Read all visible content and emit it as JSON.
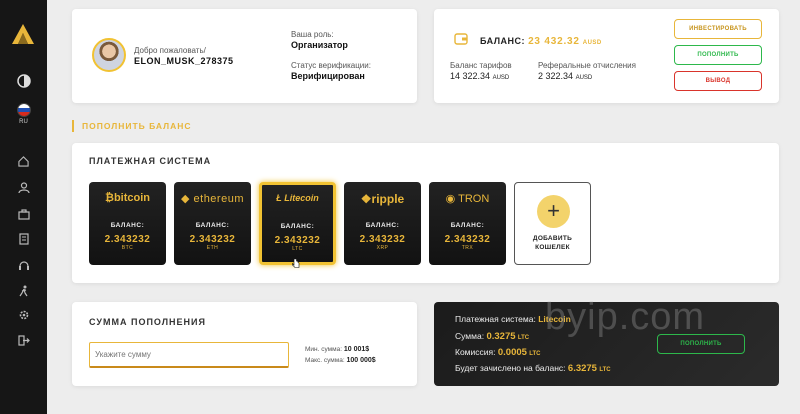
{
  "sidebar": {
    "language": "RU"
  },
  "header": {
    "welcome_label": "Добро пожаловать/",
    "username": "ELON_MUSK_278375",
    "role_label": "Ваша роль:",
    "role_value": "Организатор",
    "verification_label": "Статус верификации:",
    "verification_value": "Верифицирован"
  },
  "balance": {
    "title": "БАЛАНС:",
    "amount": "23 432.32",
    "currency": "AUSD",
    "tariff_label": "Баланс тарифов",
    "tariff_value": "14 322.34",
    "referral_label": "Реферальные отчисления",
    "referral_value": "2 322.34",
    "invest_button": "ИНВЕСТИРОВАТЬ",
    "topup_button": "ПОПОЛНИТЬ",
    "withdraw_button": "ВЫВОД"
  },
  "page_title": "ПОПОЛНИТЬ БАЛАНС",
  "payment": {
    "title": "ПЛАТЕЖНАЯ СИСТЕМА",
    "balance_label": "БАЛАНС:",
    "coins": [
      {
        "name": "bitcoin",
        "value": "2.343232",
        "currency": "BTC"
      },
      {
        "name": "ethereum",
        "value": "2.343232",
        "currency": "ETH"
      },
      {
        "name": "Litecoin",
        "value": "2.343232",
        "currency": "LTC"
      },
      {
        "name": "ripple",
        "value": "2.343232",
        "currency": "XRP"
      },
      {
        "name": "TRON",
        "value": "2.343232",
        "currency": "TRX"
      }
    ],
    "add_wallet_line1": "ДОБАВИТЬ",
    "add_wallet_line2": "КОШЕЛЕК",
    "selected_index": 2
  },
  "amount": {
    "title": "СУММА ПОПОЛНЕНИЯ",
    "placeholder": "Укажите сумму",
    "min_label": "Мин. сумма:",
    "min_value": "10 001$",
    "max_label": "Макс. сумма:",
    "max_value": "100 000$"
  },
  "summary": {
    "system_label": "Платежная система:",
    "system_value": "Litecoin",
    "amount_label": "Сумма:",
    "amount_value": "0.3275",
    "fee_label": "Комиссия:",
    "fee_value": "0.0005",
    "credited_label": "Будет зачислено на баланс:",
    "credited_value": "6.3275",
    "currency": "LTC",
    "topup_button": "ПОПОЛНИТЬ"
  },
  "watermark": "byip.com",
  "colors": {
    "accent": "#e8b63a",
    "dark": "#161616",
    "success": "#2db84b",
    "danger": "#d9342b"
  }
}
